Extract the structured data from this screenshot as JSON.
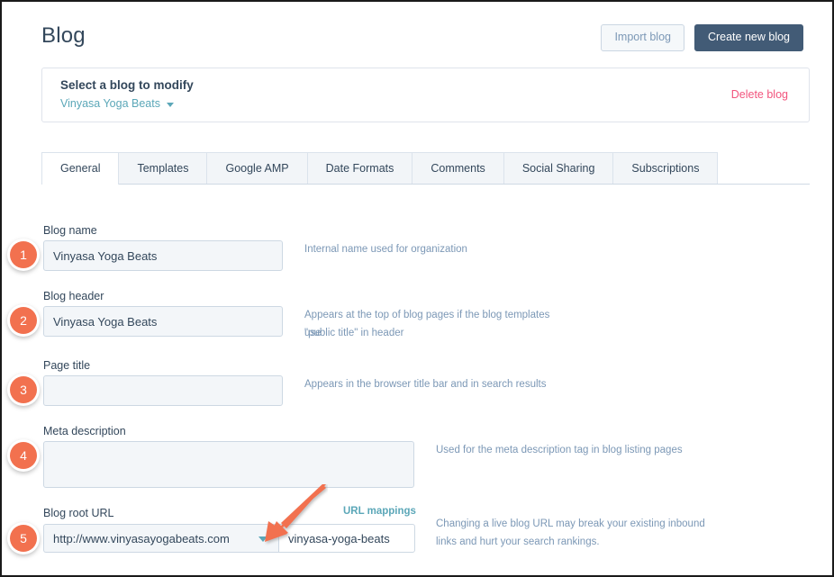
{
  "header": {
    "title": "Blog",
    "import_button": "Import blog",
    "create_button": "Create new blog"
  },
  "select_card": {
    "title": "Select a blog to modify",
    "selected_blog": "Vinyasa Yoga Beats",
    "delete_link": "Delete blog"
  },
  "tabs": [
    {
      "label": "General",
      "active": true
    },
    {
      "label": "Templates",
      "active": false
    },
    {
      "label": "Google AMP",
      "active": false
    },
    {
      "label": "Date Formats",
      "active": false
    },
    {
      "label": "Comments",
      "active": false
    },
    {
      "label": "Social Sharing",
      "active": false
    },
    {
      "label": "Subscriptions",
      "active": false
    }
  ],
  "fields": {
    "blog_name": {
      "label": "Blog name",
      "value": "Vinyasa Yoga Beats",
      "placeholder": "",
      "helper": "Internal name used for organization",
      "badge": "1"
    },
    "blog_header": {
      "label": "Blog header",
      "value": "Vinyasa Yoga Beats",
      "placeholder": "",
      "helper_line1": "Appears at the top of blog pages if the blog templates use",
      "helper_line2": "\"public title\" in header",
      "badge": "2"
    },
    "page_title": {
      "label": "Page title",
      "value": "",
      "placeholder": "",
      "helper": "Appears in the browser title bar and in search results",
      "badge": "3"
    },
    "meta_description": {
      "label": "Meta description",
      "value": "",
      "placeholder": "",
      "helper": "Used for the meta description tag in blog listing pages",
      "badge": "4"
    },
    "blog_root_url": {
      "label": "Blog root URL",
      "mappings_link": "URL mappings",
      "domain_value": "http://www.vinyasayogabeats.com",
      "slug_value": "vinyasa-yoga-beats",
      "slug_placeholder": "",
      "helper_line1": "Changing a live blog URL may break your existing inbound",
      "helper_line2": "links and hurt your search rankings.",
      "badge": "5"
    }
  },
  "colors": {
    "accent_teal": "#5ba7b8",
    "primary_navy": "#425b76",
    "danger_pink": "#f2547d",
    "annotation_orange": "#f2714f",
    "text_navy": "#33475b",
    "helper_blue": "#7c98b6"
  }
}
